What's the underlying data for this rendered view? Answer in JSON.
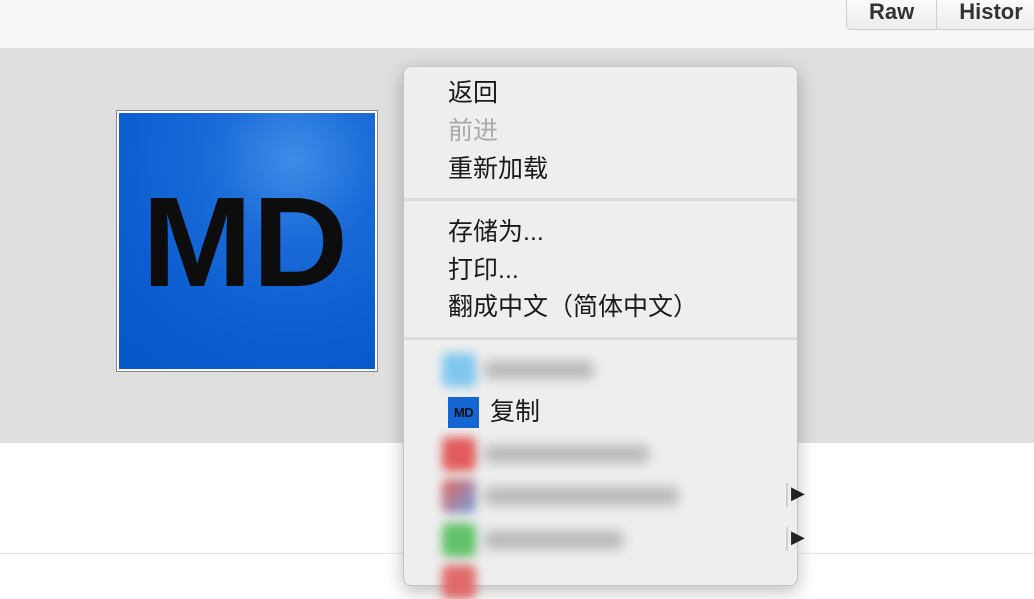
{
  "toolbar": {
    "raw_label": "Raw",
    "history_label": "Histor"
  },
  "image": {
    "logo_text": "MD",
    "bg_color": "#0a5ccf"
  },
  "context_menu": {
    "back": "返回",
    "forward": "前进",
    "reload": "重新加载",
    "save_as": "存储为...",
    "print": "打印...",
    "translate": "翻成中文（简体中文）",
    "copy": "复制",
    "copy_icon_text": "MD",
    "submenu_arrow": "▶"
  }
}
